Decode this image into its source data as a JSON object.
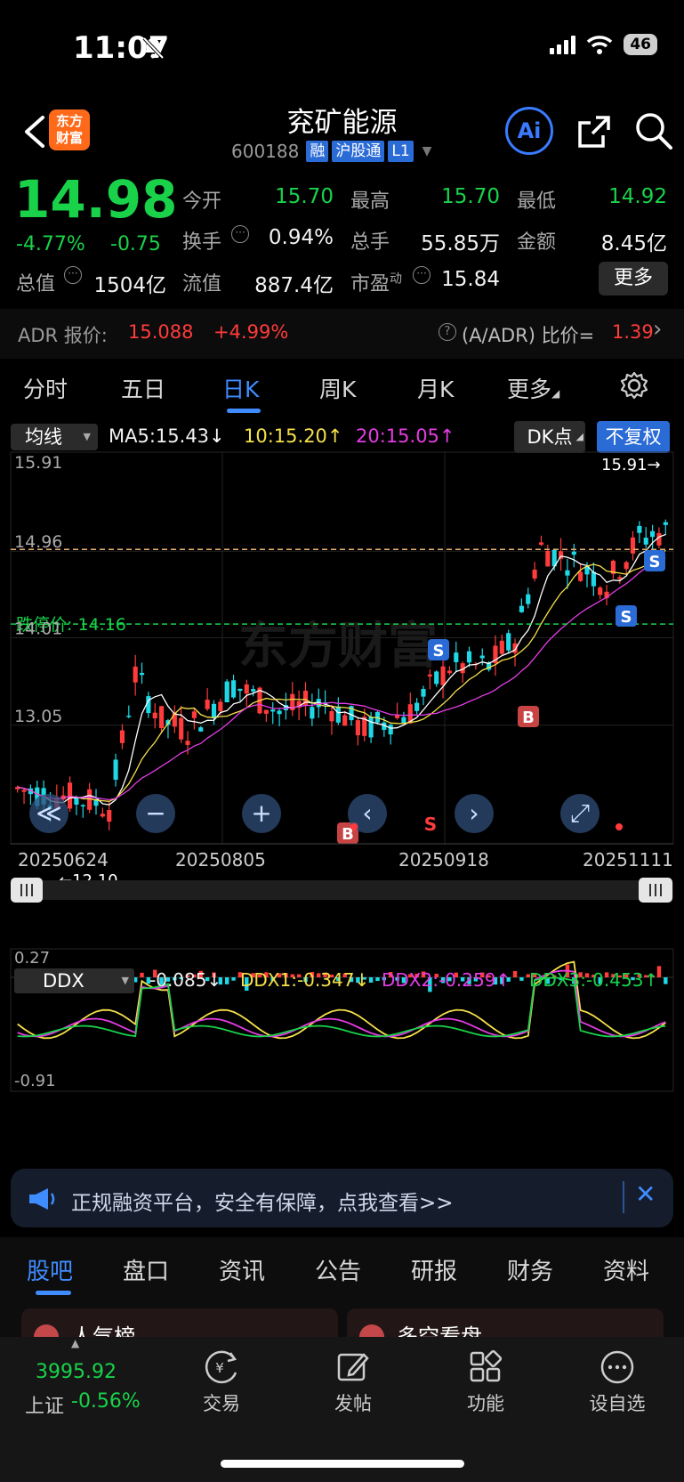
{
  "status": {
    "time": "11:07",
    "battery": "46"
  },
  "header": {
    "logo_line1": "东方",
    "logo_line2": "财富",
    "name": "兖矿能源",
    "code": "600188",
    "tags": [
      "融",
      "沪股通",
      "L1"
    ],
    "ai_label": "Ai"
  },
  "quote": {
    "price": "14.98",
    "change_pct": "-4.77%",
    "change": "-0.75",
    "fields": [
      {
        "label": "今开",
        "value": "15.70"
      },
      {
        "label": "最高",
        "value": "15.70"
      },
      {
        "label": "最低",
        "value": "14.92"
      },
      {
        "label": "换手",
        "value": "0.94%"
      },
      {
        "label": "总手",
        "value": "55.85万"
      },
      {
        "label": "金额",
        "value": "8.45亿"
      },
      {
        "label": "总值",
        "value": "1504亿"
      },
      {
        "label": "流值",
        "value": "887.4亿"
      },
      {
        "label": "市盈",
        "label_sup": "动",
        "value": "15.84"
      }
    ],
    "more": "更多"
  },
  "adr": {
    "label": "ADR 报价:",
    "price": "15.088",
    "pct": "+4.99%",
    "ratio_label": "(A/ADR) 比价=",
    "ratio": "1.39"
  },
  "tabs": [
    "分时",
    "五日",
    "日K",
    "周K",
    "月K",
    "更多"
  ],
  "active_tab": "日K",
  "kline": {
    "ma_select": "均线",
    "ma5": "MA5:15.43",
    "ma10": "10:15.20",
    "ma20": "20:15.05",
    "dk_button": "DK点",
    "adjust_button": "不复权",
    "y_labels": [
      "15.91",
      "14.96",
      "14.01",
      "13.05"
    ],
    "high_marker": "15.91",
    "low_marker": "12.10",
    "limit_down_label": "跌停价: 14.16",
    "dates": [
      "20250624",
      "20250805",
      "20250918",
      "20251111"
    ],
    "watermark": "东方财富",
    "signal_s": "S",
    "signal_b": "B"
  },
  "ddx": {
    "select": "DDX",
    "value": "-0.085",
    "ddx1": "DDX1:-0.347",
    "ddx2": "DDX2:-0.259",
    "ddx3": "DDX3:-0.453",
    "y_top": "0.27",
    "y_bottom": "-0.91"
  },
  "banner": {
    "text": "正规融资平台，安全有保障，点我查看>>"
  },
  "bottom_tabs": [
    "股吧",
    "盘口",
    "资讯",
    "公告",
    "研报",
    "财务",
    "资料"
  ],
  "panels": [
    "人气榜",
    "多空看盘"
  ],
  "footer": {
    "index_value": "3995.92",
    "index_name": "上证",
    "index_pct": "-0.56%",
    "items": [
      "交易",
      "发帖",
      "功能",
      "设自选"
    ]
  },
  "colors": {
    "up": "#ff3b3b",
    "down": "#19d24a",
    "accent": "#3f8cff",
    "candle_down": "#1fd8e6"
  }
}
